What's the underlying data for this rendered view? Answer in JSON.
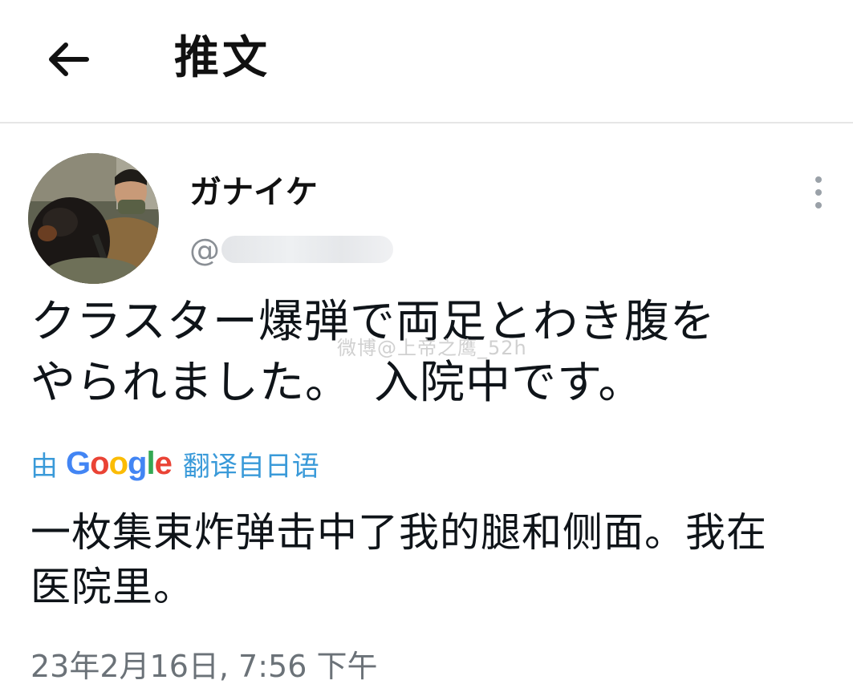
{
  "header": {
    "back_icon": "arrow-left-icon",
    "title": "推文"
  },
  "author": {
    "name": "ガナイケ",
    "handle_prefix": "@",
    "avatar_icon": "profile-photo",
    "more_icon": "more-vertical-icon"
  },
  "tweet": {
    "text_line1": "クラスター爆弾で両足とわき腹を",
    "text_line2": "やられました。　入院中です。",
    "watermark": "微博@上帝之鹰_52h"
  },
  "translation": {
    "by_label": "由",
    "google_label": "Google",
    "from_label": "翻译自日语",
    "text_line1": "一枚集束炸弹击中了我的腿和侧面。我在",
    "text_line2": "医院里。"
  },
  "timestamp": "23年2月16日, 7:56 下午",
  "colors": {
    "accent": "#1d9bf0",
    "text": "#0f1419",
    "secondary": "#6b7278",
    "divider": "#e6e6e6"
  }
}
